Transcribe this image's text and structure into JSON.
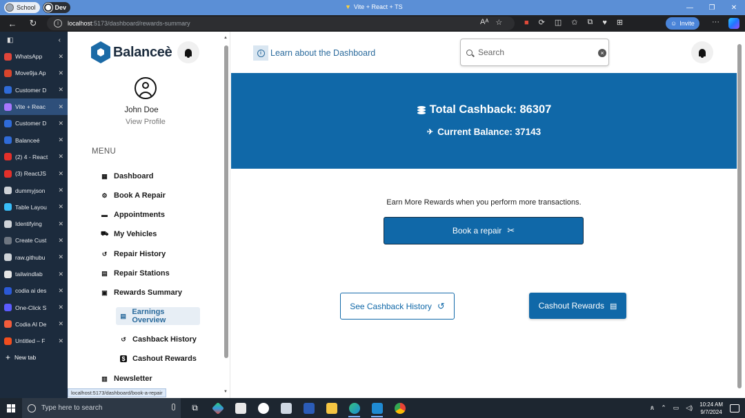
{
  "browser": {
    "profiles": [
      "School",
      "Dev"
    ],
    "tab_title": "Vite + React + TS",
    "url_host": "localhost",
    "url_path": ":5173/dashboard/rewards-summary",
    "invite_label": "Invite",
    "status_url": "localhost:5173/dashboard/book-a-repair"
  },
  "vertical_tabs": {
    "items": [
      {
        "label": "WhatsApp",
        "color": "#e0453a"
      },
      {
        "label": "Move9ja Ap",
        "color": "#d8452c"
      },
      {
        "label": "Customer D",
        "color": "#2f6bd8"
      },
      {
        "label": "Vite + Reac",
        "color": "#a877ff",
        "active": true
      },
      {
        "label": "Customer D",
        "color": "#2f6bd8"
      },
      {
        "label": "Balanceé",
        "color": "#2f6bd8"
      },
      {
        "label": "(2) 4 - React",
        "color": "#e3302a"
      },
      {
        "label": "(3) ReactJS",
        "color": "#e3302a"
      },
      {
        "label": "dummyjson",
        "color": "#cfd3d8"
      },
      {
        "label": "Table Layou",
        "color": "#38bdf8"
      },
      {
        "label": "Identifying",
        "color": "#cfd3d8"
      },
      {
        "label": "Create Cust",
        "color": "#6e7681"
      },
      {
        "label": "raw.githubu",
        "color": "#cfd3d8"
      },
      {
        "label": "tailwindlab",
        "color": "#e6e6e6"
      },
      {
        "label": "codia ai des",
        "color": "#2b59d6"
      },
      {
        "label": "One-Click S",
        "color": "#5b5bff"
      },
      {
        "label": "Codia AI De",
        "color": "#f25c3b"
      },
      {
        "label": "Untitled – F",
        "color": "#f24e1e"
      }
    ],
    "new_tab_label": "New tab"
  },
  "sidebar": {
    "brand": "Balanceè",
    "user_name": "John Doe",
    "view_profile": "View Profile",
    "menu_label": "MENU",
    "nav": [
      {
        "label": "Dashboard",
        "icon": "grid-icon"
      },
      {
        "label": "Book A Repair",
        "icon": "tools-icon"
      },
      {
        "label": "Appointments",
        "icon": "calendar-icon"
      },
      {
        "label": "My Vehicles",
        "icon": "car-icon"
      },
      {
        "label": "Repair History",
        "icon": "history-icon"
      },
      {
        "label": "Repair Stations",
        "icon": "station-icon"
      },
      {
        "label": "Rewards Summary",
        "icon": "gift-icon"
      }
    ],
    "sub_nav": [
      {
        "label": "Earnings Overview",
        "icon": "chart-icon",
        "active": true
      },
      {
        "label": "Cashback History",
        "icon": "history-icon"
      },
      {
        "label": "Cashout Rewards",
        "icon": "dollar-icon"
      }
    ],
    "newsletter": "Newsletter"
  },
  "topbar": {
    "learn_link": "Learn about the Dashboard",
    "search_placeholder": "Search"
  },
  "rewards": {
    "total_cashback": "Total Cashback: 86307",
    "current_balance": "Current Balance: 37143",
    "earn_text": "Earn More Rewards when you perform more transactions.",
    "book_button": "Book a repair",
    "history_button": "See Cashback History",
    "cashout_button": "Cashout Rewards"
  },
  "taskbar": {
    "search_placeholder": "Type here to search",
    "time": "10:24 AM",
    "date": "9/7/2024"
  },
  "colors": {
    "brand_blue": "#1068a8",
    "link_blue": "#2a6a9c"
  }
}
